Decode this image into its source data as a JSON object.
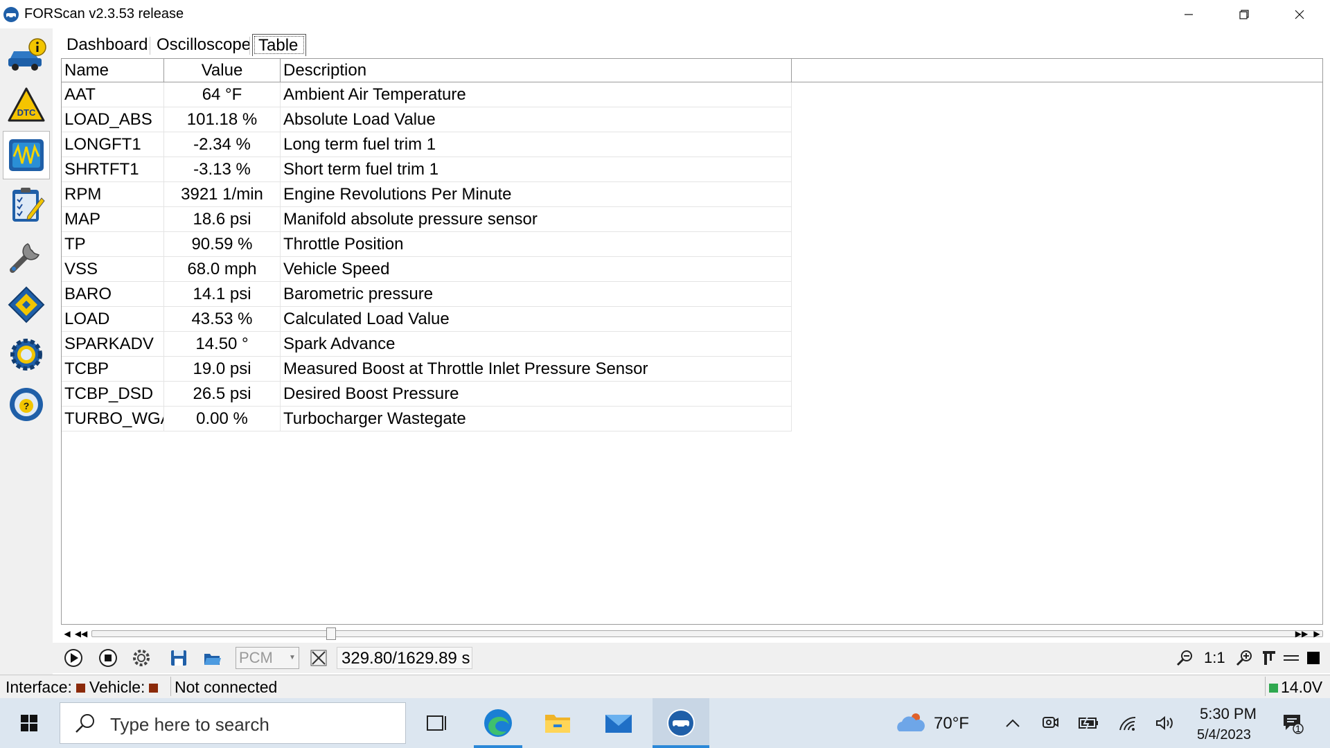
{
  "window": {
    "title": "FORScan v2.3.53 release"
  },
  "sidebar": {
    "items": [
      {
        "name": "vehicle-info"
      },
      {
        "name": "dtc"
      },
      {
        "name": "oscilloscope"
      },
      {
        "name": "tests"
      },
      {
        "name": "service-functions"
      },
      {
        "name": "configuration"
      },
      {
        "name": "settings"
      },
      {
        "name": "help"
      }
    ]
  },
  "tabs": [
    "Dashboard",
    "Oscilloscope",
    "Table"
  ],
  "table": {
    "headers": [
      "Name",
      "Value",
      "Description"
    ],
    "rows": [
      {
        "name": "AAT",
        "value": "64 °F",
        "desc": "Ambient Air Temperature"
      },
      {
        "name": "LOAD_ABS",
        "value": "101.18 %",
        "desc": "Absolute Load Value"
      },
      {
        "name": "LONGFT1",
        "value": "-2.34 %",
        "desc": "Long term fuel trim 1"
      },
      {
        "name": "SHRTFT1",
        "value": "-3.13 %",
        "desc": "Short term fuel trim 1"
      },
      {
        "name": "RPM",
        "value": "3921 1/min",
        "desc": "Engine Revolutions Per Minute"
      },
      {
        "name": "MAP",
        "value": "18.6 psi",
        "desc": "Manifold absolute pressure sensor"
      },
      {
        "name": "TP",
        "value": "90.59 %",
        "desc": "Throttle Position"
      },
      {
        "name": "VSS",
        "value": "68.0 mph",
        "desc": "Vehicle Speed"
      },
      {
        "name": "BARO",
        "value": "14.1 psi",
        "desc": "Barometric pressure"
      },
      {
        "name": "LOAD",
        "value": "43.53 %",
        "desc": "Calculated Load Value"
      },
      {
        "name": "SPARKADV",
        "value": "14.50 °",
        "desc": "Spark Advance"
      },
      {
        "name": "TCBP",
        "value": "19.0 psi",
        "desc": "Measured Boost at Throttle Inlet Pressure Sensor"
      },
      {
        "name": "TCBP_DSD",
        "value": "26.5 psi",
        "desc": "Desired Boost Pressure"
      },
      {
        "name": "TURBO_WGAT",
        "value": "0.00 %",
        "desc": "Turbocharger Wastegate"
      }
    ]
  },
  "toolbar": {
    "module_select": "PCM",
    "time_display": "329.80/1629.89 s",
    "zoom_ratio": "1:1"
  },
  "statusbar": {
    "interface_label": "Interface:",
    "vehicle_label": "Vehicle:",
    "connection_status": "Not connected",
    "voltage": "14.0V",
    "status_color": "#8b2a0a",
    "voltage_color": "#2fa84f"
  },
  "taskbar": {
    "search_placeholder": "Type here to search",
    "weather_temp": "70°F",
    "time": "5:30 PM",
    "date": "5/4/2023",
    "notification_count": "1"
  }
}
